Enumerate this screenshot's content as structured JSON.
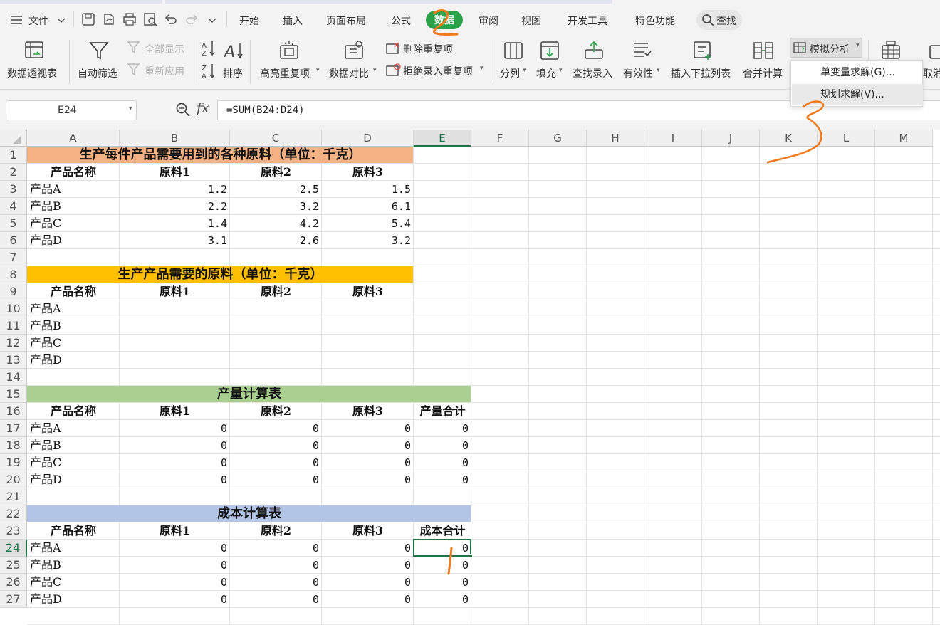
{
  "menubar": {
    "file_label": "文件",
    "tabs": [
      "开始",
      "插入",
      "页面布局",
      "公式",
      "数据",
      "审阅",
      "视图",
      "开发工具",
      "特色功能"
    ],
    "active_tab": "数据",
    "search_label": "查找"
  },
  "ribbon": {
    "pivot": "数据透视表",
    "autofilter": "自动筛选",
    "show_all": "全部显示",
    "reapply": "重新应用",
    "sort": "排序",
    "highlight_dup": "高亮重复项",
    "data_compare": "数据对比",
    "remove_dup": "删除重复项",
    "reject_dup": "拒绝录入重复项",
    "split": "分列",
    "fill": "填充",
    "lookup": "查找录入",
    "validity": "有效性",
    "insert_dropdown": "插入下拉列表",
    "consolidate": "合并计算",
    "whatif": "模拟分析",
    "cut_partial": "取消纟"
  },
  "dropdown": {
    "items": [
      "单变量求解(G)...",
      "规划求解(V)..."
    ]
  },
  "formula_bar": {
    "cell_ref": "E24",
    "fx": "fx",
    "formula": "=SUM(B24:D24)"
  },
  "grid": {
    "columns": [
      "A",
      "B",
      "C",
      "D",
      "E",
      "F",
      "G",
      "H",
      "I",
      "J",
      "K",
      "L",
      "M"
    ],
    "selected_column": "E",
    "selected_row": "24",
    "rows": [
      "1",
      "2",
      "3",
      "4",
      "5",
      "6",
      "7",
      "8",
      "9",
      "10",
      "11",
      "12",
      "13",
      "14",
      "15",
      "16",
      "17",
      "18",
      "19",
      "20",
      "21",
      "22",
      "23",
      "24",
      "25",
      "26",
      "27"
    ]
  },
  "sheet": {
    "t1_title": "生产每件产品需要用到的各种原料（单位：千克）",
    "t2_title": "生产产品需要的原料（单位：千克）",
    "t3_title": "产量计算表",
    "t4_title": "成本计算表",
    "h_name": "产品名称",
    "h_m1": "原料1",
    "h_m2": "原料2",
    "h_m3": "原料3",
    "h_total_qty": "产量合计",
    "h_total_cost": "成本合计",
    "products": [
      "产品A",
      "产品B",
      "产品C",
      "产品D"
    ],
    "t1_values": [
      [
        "1.2",
        "2.5",
        "1.5"
      ],
      [
        "2.2",
        "3.2",
        "6.1"
      ],
      [
        "1.4",
        "4.2",
        "5.4"
      ],
      [
        "3.1",
        "2.6",
        "3.2"
      ]
    ],
    "t3_values": [
      [
        "0",
        "0",
        "0",
        "0"
      ],
      [
        "0",
        "0",
        "0",
        "0"
      ],
      [
        "0",
        "0",
        "0",
        "0"
      ],
      [
        "0",
        "0",
        "0",
        "0"
      ]
    ],
    "t4_values": [
      [
        "0",
        "0",
        "0",
        "0"
      ],
      [
        "0",
        "0",
        "0",
        "0"
      ],
      [
        "0",
        "0",
        "0",
        "0"
      ],
      [
        "0",
        "0",
        "0",
        "0"
      ]
    ]
  },
  "colors": {
    "t1_fill": "#f4b183",
    "t2_fill": "#ffc000",
    "t3_fill": "#a9d08e",
    "t4_fill": "#b4c6e7",
    "active_tab": "#2aa24a",
    "annotation": "#f07a1e",
    "selection": "#217346"
  },
  "annotations": [
    "2",
    "3"
  ]
}
